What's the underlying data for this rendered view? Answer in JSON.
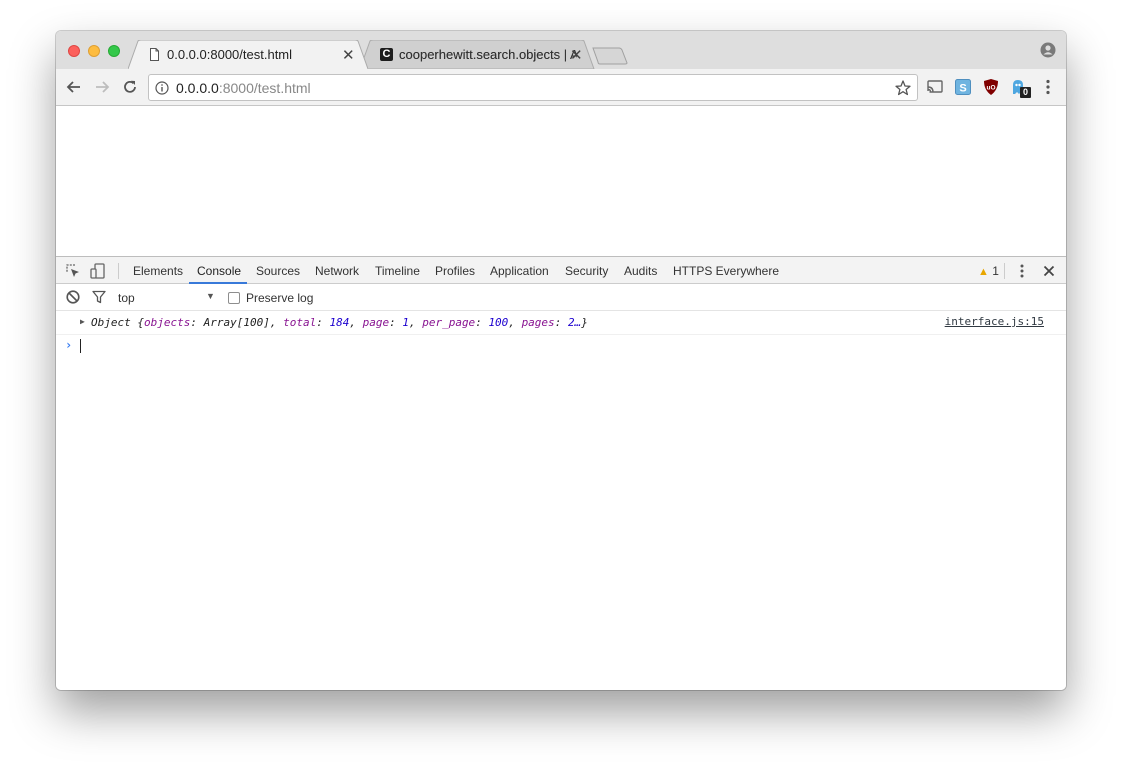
{
  "browser": {
    "tabs": [
      {
        "title": "0.0.0.0:8000/test.html",
        "icon": "page-icon",
        "active": true
      },
      {
        "title": "cooperhewitt.search.objects | API m",
        "icon": "c-favicon",
        "favicon_letter": "C",
        "active": false
      }
    ],
    "omnibox": {
      "host": "0.0.0.0",
      "rest": ":8000/test.html"
    },
    "extensions": [
      "cast-icon",
      "s-extension-icon",
      "ublock-icon",
      "ghostery-icon"
    ],
    "ghostery_badge": "0"
  },
  "devtools": {
    "tabs": [
      "Elements",
      "Console",
      "Sources",
      "Network",
      "Timeline",
      "Profiles",
      "Application",
      "Security",
      "Audits",
      "HTTPS Everywhere"
    ],
    "active_tab": "Console",
    "warning_count": "1",
    "context": "top",
    "preserve_log_label": "Preserve log",
    "preserve_log_checked": false,
    "console": {
      "log": {
        "prefix": "Object {",
        "fields": [
          {
            "key": "objects",
            "value": "Array[100]",
            "type": "object"
          },
          {
            "key": "total",
            "value": "184",
            "type": "number"
          },
          {
            "key": "page",
            "value": "1",
            "type": "number"
          },
          {
            "key": "per_page",
            "value": "100",
            "type": "number"
          },
          {
            "key": "pages",
            "value": "2…",
            "type": "number"
          }
        ],
        "suffix": "}",
        "source": "interface.js:15"
      }
    }
  },
  "colors": {
    "accent": "#3879d9",
    "console_key": "#881391",
    "console_number": "#1c00cf",
    "warning": "#e8a600"
  }
}
